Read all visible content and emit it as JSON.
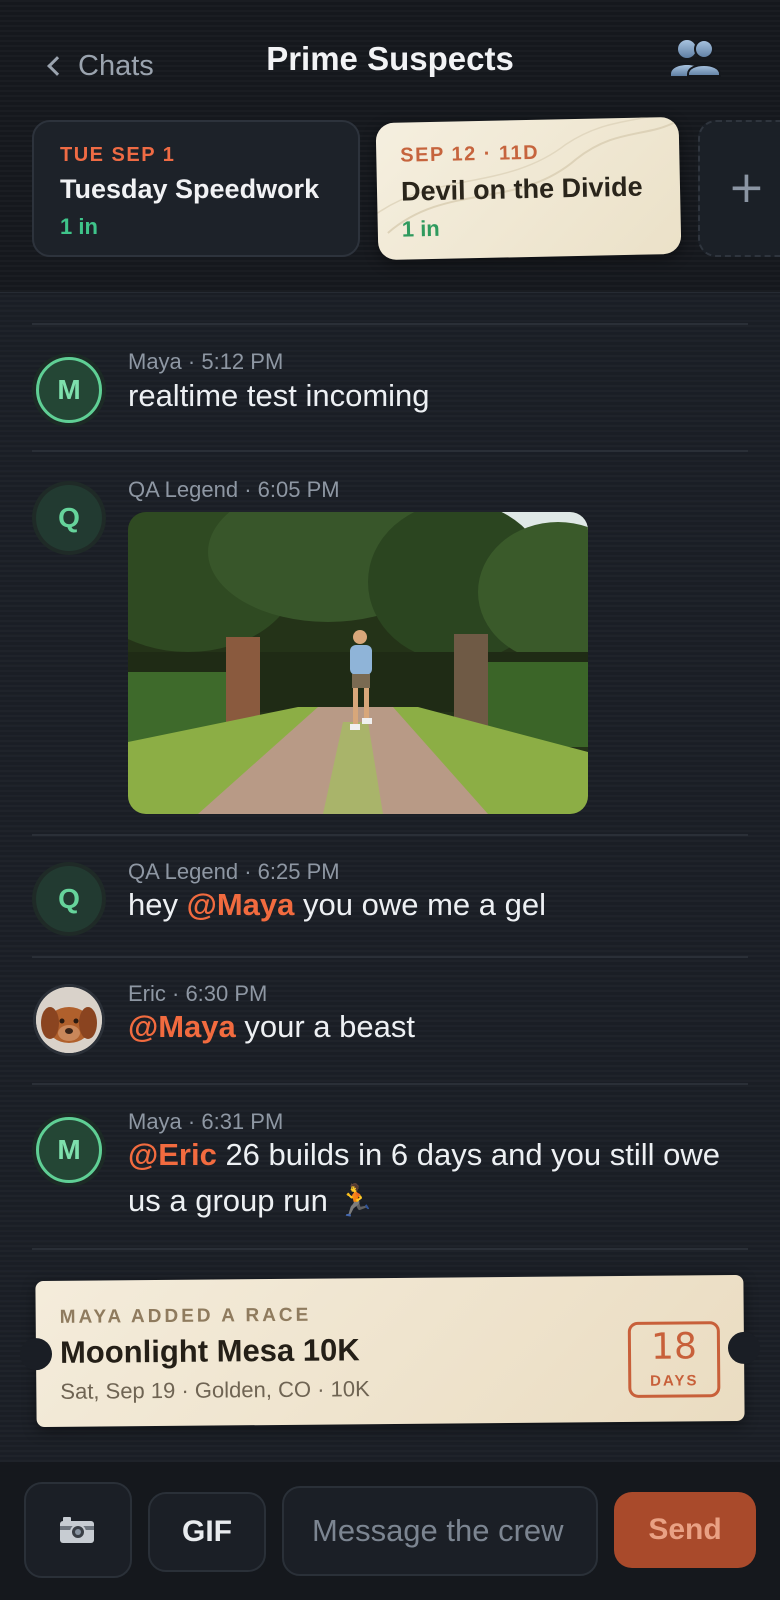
{
  "header": {
    "back_label": "Chats",
    "title": "Prime Suspects",
    "members_icon": "people-icon"
  },
  "events": [
    {
      "date": "TUE SEP 1",
      "name": "Tuesday Speedwork",
      "rsvp": "1 in"
    },
    {
      "date": "SEP 12 · 11D",
      "name": "Devil on the Divide",
      "rsvp": "1 in"
    }
  ],
  "add_event_icon": "plus-icon",
  "messages": [
    {
      "author": "Maya",
      "time": "5:12 PM",
      "meta": "Maya · 5:12 PM",
      "avatar_initial": "M",
      "text": "realtime test incoming"
    },
    {
      "author": "QA Legend",
      "time": "6:05 PM",
      "meta": "QA Legend · 6:05 PM",
      "avatar_initial": "Q",
      "gif": true
    },
    {
      "author": "QA Legend",
      "time": "6:25 PM",
      "meta": "QA Legend · 6:25 PM",
      "avatar_initial": "Q",
      "before": "hey ",
      "mention": "@Maya",
      "after": " you owe me a gel"
    },
    {
      "author": "Eric",
      "time": "6:30 PM",
      "meta": "Eric · 6:30 PM",
      "avatar": "dog-photo",
      "mention": "@Maya",
      "after": " your a beast"
    },
    {
      "author": "Maya",
      "time": "6:31 PM",
      "meta": "Maya · 6:31 PM",
      "avatar_initial": "M",
      "mention": "@Eric",
      "after": " 26 builds in 6 days and you still owe us a group run 🏃"
    }
  ],
  "race_card": {
    "label": "MAYA ADDED A RACE",
    "title": "Moonlight Mesa 10K",
    "details": "Sat, Sep 19 · Golden, CO · 10K",
    "days": "18",
    "days_label": "DAYS"
  },
  "composer": {
    "camera_icon": "camera-icon",
    "gif_label": "GIF",
    "placeholder": "Message the crew",
    "value": "",
    "send_label": "Send"
  },
  "colors": {
    "background": "#1a1e25",
    "accent_orange": "#f26b3f",
    "online_green": "#3fc48a",
    "ticket_cream": "#f4ecdb",
    "send_button": "#a94a2b"
  }
}
